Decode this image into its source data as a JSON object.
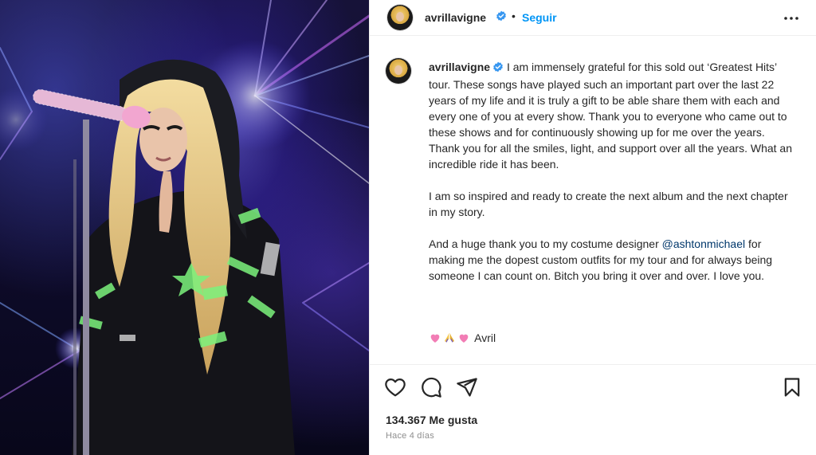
{
  "post": {
    "image_alt": "Concert photo: blonde singer in a hooded jacket at a sparkly microphone, hands pressed together, under blue stage lights"
  },
  "header": {
    "username": "avrillavigne",
    "separator": "•",
    "follow_label": "Seguir",
    "more_icon": "more-options-icon"
  },
  "caption": {
    "username": "avrillavigne",
    "paragraph1": "I am immensely grateful for this sold out ‘Greatest Hits’ tour. These songs have played such an important part over the last 22 years of my life and it is truly a gift to be able share them with each and every one of you at every show. Thank you to everyone who came out to these shows and for continuously showing up for me over the years. Thank you for all the smiles, light, and support over all the years. What an incredible ride it has been.",
    "paragraph2": "I am so inspired and ready to create the next album and the next chapter in my story.",
    "paragraph3_before": "And a huge thank you to my costume designer ",
    "mention": "@ashtonmichael",
    "paragraph3_after": " for making me the dopest custom outfits for my tour and for always being someone I can count on. Bitch you bring it over and over. I love you.",
    "signature": "Avril",
    "signature_emojis": [
      "pink-heart-icon",
      "praying-hands-icon",
      "pink-heart-icon"
    ]
  },
  "actions": {
    "like_icon": "heart-icon",
    "comment_icon": "comment-icon",
    "share_icon": "paper-plane-icon",
    "save_icon": "bookmark-icon"
  },
  "stats": {
    "likes": "134.367 Me gusta",
    "time_ago": "Hace 4 días"
  },
  "colors": {
    "link_blue": "#0095f6",
    "mention_blue": "#00376b",
    "verified_blue": "#3897f0",
    "text": "#262626",
    "muted": "#8e8e8e"
  }
}
